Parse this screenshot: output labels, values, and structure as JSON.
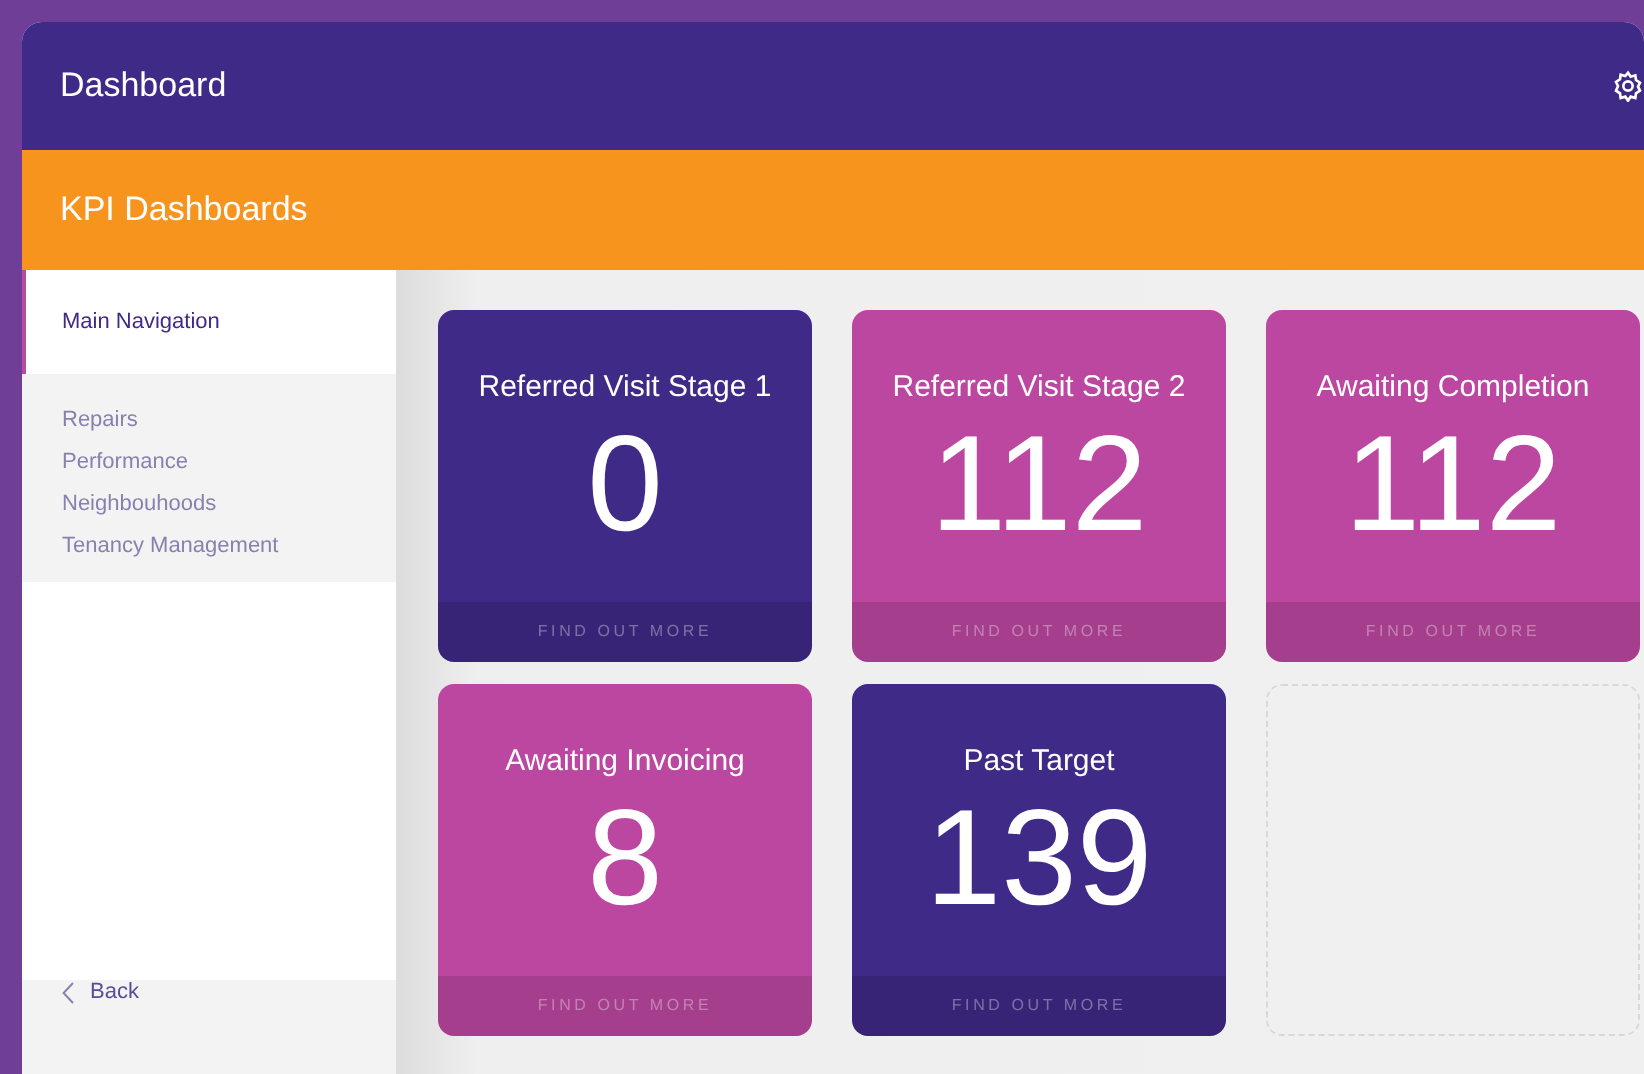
{
  "window": {
    "title": "Dashboard"
  },
  "page_header": {
    "title": "KPI Dashboards"
  },
  "sidebar": {
    "heading": "Main Navigation",
    "items": [
      {
        "label": "Repairs"
      },
      {
        "label": "Performance"
      },
      {
        "label": "Neighbouhoods"
      },
      {
        "label": "Tenancy Management"
      }
    ],
    "back": {
      "label": "Back"
    }
  },
  "cards": [
    {
      "kind": "tile",
      "title": "Referred Visit Stage 1",
      "value": "0",
      "link": "FIND OUT MORE",
      "color": "#3f2a87"
    },
    {
      "kind": "tile",
      "title": "Referred Visit Stage 2",
      "value": "112",
      "link": "FIND OUT MORE",
      "color": "#bc47a0"
    },
    {
      "kind": "tile",
      "title": "Awaiting Completion",
      "value": "112",
      "link": "FIND OUT MORE",
      "color": "#bc47a0"
    },
    {
      "kind": "tile",
      "title": "Awaiting Invoicing",
      "value": "8",
      "link": "FIND OUT MORE",
      "color": "#bc47a0"
    },
    {
      "kind": "tile",
      "title": "Past Target",
      "value": "139",
      "link": "FIND OUT MORE",
      "color": "#3f2a87"
    },
    {
      "kind": "empty"
    }
  ]
}
